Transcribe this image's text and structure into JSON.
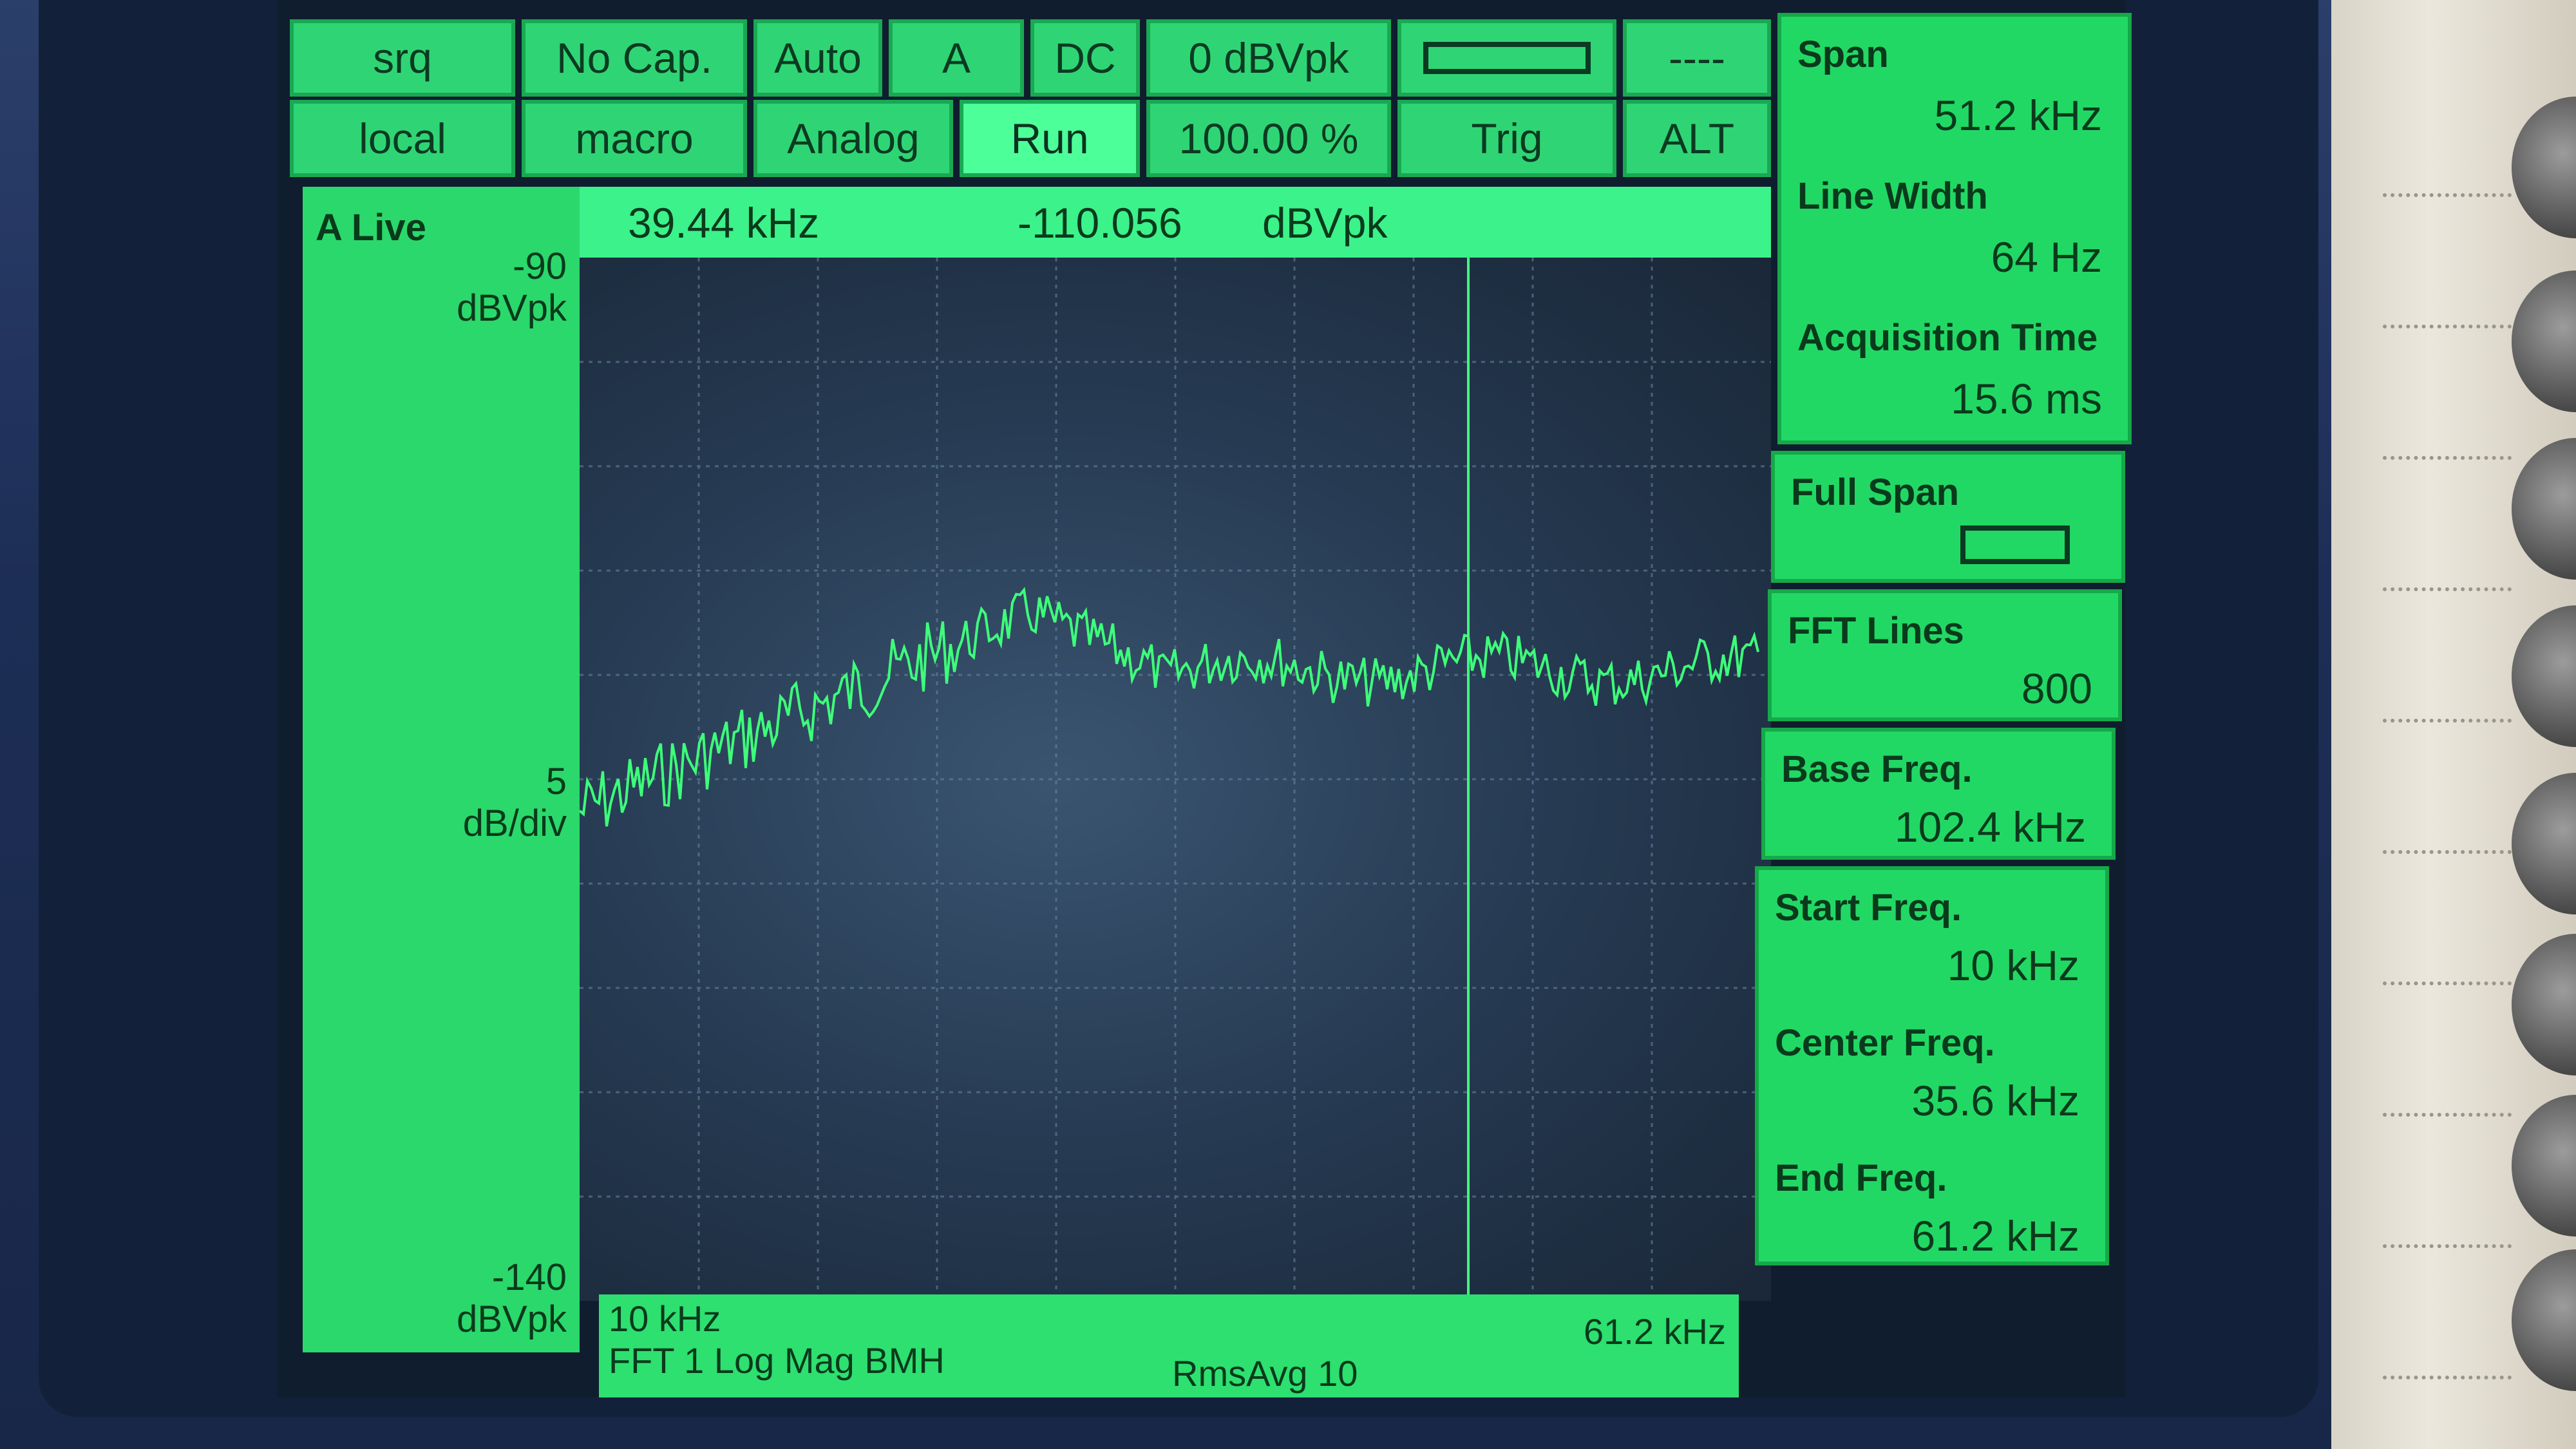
{
  "top_buttons_row1": [
    "srq",
    "No Cap.",
    "Auto",
    "A",
    "DC",
    "0 dBVpk",
    "----"
  ],
  "top_buttons_row2": [
    "local",
    "macro",
    "Analog",
    "Run",
    "100.00 %",
    "Trig",
    "ALT"
  ],
  "readout": {
    "freq": "39.44 kHz",
    "value": "-110.056",
    "unit": "dBVpk"
  },
  "left_scale": {
    "title": "A Live",
    "top": "-90",
    "top_unit": "dBVpk",
    "mid": "5",
    "mid_unit": "dB/div",
    "bottom": "-140",
    "bottom_unit": "dBVpk"
  },
  "bottom_bar": {
    "start": "10 kHz",
    "end": "61.2 kHz",
    "trace": "FFT 1 Log Mag BMH",
    "avg": "RmsAvg  10"
  },
  "softkeys": [
    {
      "label": "Span",
      "value": "51.2 kHz"
    },
    {
      "label": "Line Width",
      "value": "64 Hz"
    },
    {
      "label": "Acquisition Time",
      "value": "15.6 ms"
    },
    {
      "label": "Full Span",
      "value": ""
    },
    {
      "label": "FFT Lines",
      "value": "800"
    },
    {
      "label": "Base Freq.",
      "value": "102.4 kHz"
    },
    {
      "label": "Start Freq.",
      "value": "10 kHz"
    },
    {
      "label": "Center Freq.",
      "value": "35.6 kHz"
    },
    {
      "label": "End Freq.",
      "value": "61.2 kHz"
    }
  ],
  "colors": {
    "trace": "#3dff7a",
    "panel": "#22d865",
    "grid": "#6d8aa3"
  }
}
